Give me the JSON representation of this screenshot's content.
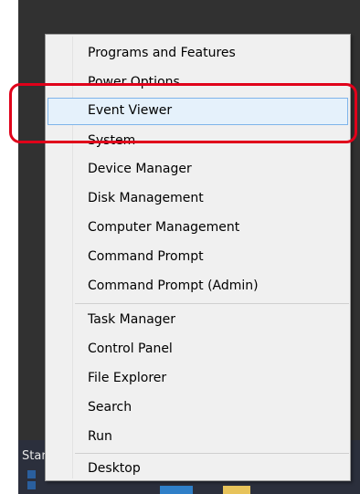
{
  "taskbar": {
    "start_label": "Start"
  },
  "menu": {
    "items": [
      {
        "label": "Programs and Features"
      },
      {
        "label": "Power Options"
      },
      {
        "label": "Event Viewer",
        "selected": true
      },
      {
        "label": "System"
      },
      {
        "label": "Device Manager"
      },
      {
        "label": "Disk Management"
      },
      {
        "label": "Computer Management"
      },
      {
        "label": "Command Prompt"
      },
      {
        "label": "Command Prompt (Admin)"
      },
      {
        "label": "Task Manager"
      },
      {
        "label": "Control Panel"
      },
      {
        "label": "File Explorer"
      },
      {
        "label": "Search"
      },
      {
        "label": "Run"
      },
      {
        "label": "Desktop"
      }
    ]
  },
  "colors": {
    "annotation_highlight": "#e0001a",
    "selected_item_fill": "#e5f1fb",
    "selected_item_border": "#7eb4ea",
    "desktop_background": "#313131",
    "taskbar_background": "#2b2f3c"
  }
}
